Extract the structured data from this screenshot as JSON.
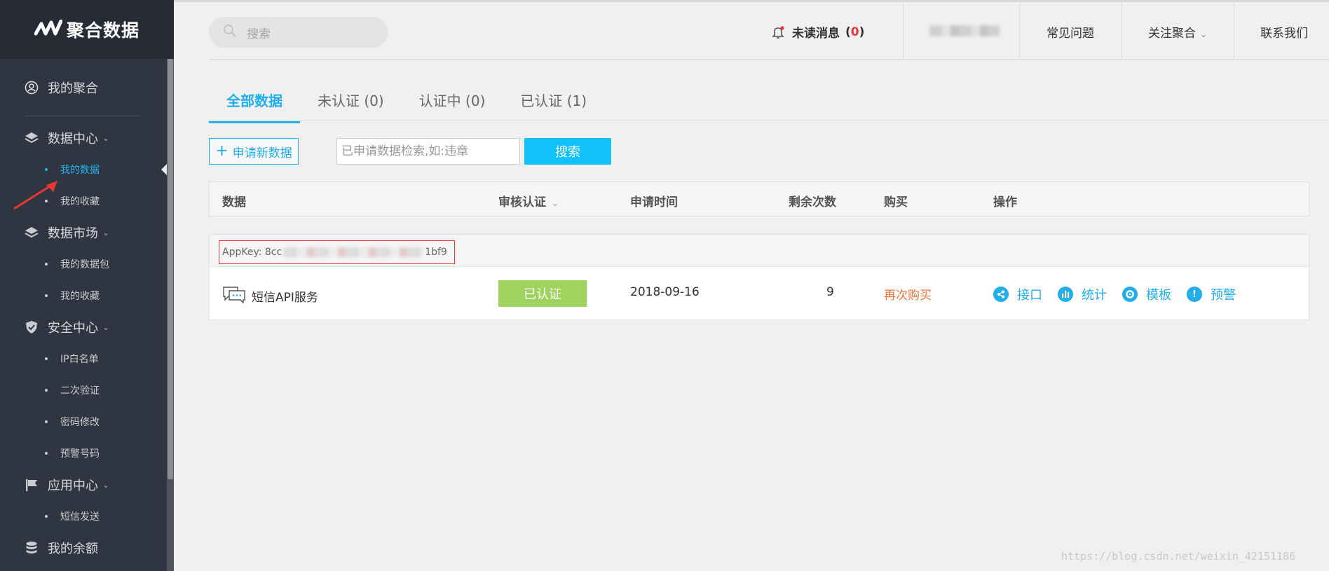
{
  "brand": {
    "name": "聚合数据",
    "logo_icon": "juhe-logo-icon"
  },
  "sidebar": {
    "top_item": {
      "label": "我的聚合",
      "icon": "user-circle-icon"
    },
    "groups": [
      {
        "label": "数据中心",
        "icon": "layers-icon",
        "items": [
          "我的数据",
          "我的收藏"
        ],
        "active_item": "我的数据"
      },
      {
        "label": "数据市场",
        "icon": "layers-icon",
        "items": [
          "我的数据包",
          "我的收藏"
        ]
      },
      {
        "label": "安全中心",
        "icon": "shield-icon",
        "items": [
          "IP白名单",
          "二次验证",
          "密码修改",
          "预警号码"
        ]
      },
      {
        "label": "应用中心",
        "icon": "flag-icon",
        "items": [
          "短信发送"
        ]
      }
    ],
    "balance": {
      "label": "我的余额",
      "icon": "database-icon"
    }
  },
  "header": {
    "search_placeholder": "搜索",
    "unread_label": "未读消息",
    "unread_open": "(",
    "unread_count": "0",
    "unread_close": ")",
    "faq": "常见问题",
    "follow": "关注聚合",
    "contact": "联系我们"
  },
  "tabs": [
    {
      "label": "全部数据",
      "active": true
    },
    {
      "label": "未认证 (0)"
    },
    {
      "label": "认证中 (0)"
    },
    {
      "label": "已认证 (1)"
    }
  ],
  "toolbar": {
    "apply_label": "申请新数据",
    "query_placeholder": "已申请数据检索,如:违章",
    "search_label": "搜索"
  },
  "table": {
    "columns": [
      "数据",
      "审核认证",
      "申请时间",
      "剩余次数",
      "购买",
      "操作"
    ],
    "rows": [
      {
        "appkey_label": "AppKey: 8cc",
        "appkey_tail": "1bf9",
        "service": "短信API服务",
        "status": "已认证",
        "date": "2018-09-16",
        "remaining": "9",
        "buy": "再次购买",
        "actions": [
          "接口",
          "统计",
          "模板",
          "预警"
        ]
      }
    ]
  },
  "colors": {
    "accent": "#22aee9",
    "sidebar": "#2f3541",
    "status_green": "#9fd25f",
    "rebuy_orange": "#f0743a"
  },
  "watermark": "https://blog.csdn.net/weixin_42151186"
}
